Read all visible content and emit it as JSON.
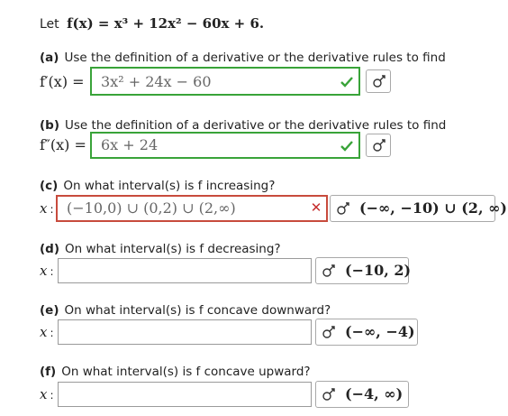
{
  "intro": {
    "text": "Let",
    "function": "f(x) = x³ + 12x² − 60x + 6."
  },
  "parts": [
    {
      "label": "(a)",
      "question": "Use the definition of a derivative or the derivative rules to find",
      "lhs": "f′(x) =",
      "answer": "3x² + 24x − 60",
      "status": "correct"
    },
    {
      "label": "(b)",
      "question": "Use the definition of a derivative or the derivative rules to find",
      "lhs": "f″(x) =",
      "answer": "6x + 24",
      "status": "correct"
    },
    {
      "label": "(c)",
      "question": "On what interval(s) is f increasing?",
      "var": "x",
      "answer": "(−10,0) ∪ (0,2) ∪ (2,∞)",
      "status": "incorrect",
      "correct_answer": "(−∞, −10) ∪ (2, ∞)"
    },
    {
      "label": "(d)",
      "question": "On what interval(s) is f decreasing?",
      "var": "x",
      "answer": "",
      "correct_answer": "(−10, 2)"
    },
    {
      "label": "(e)",
      "question": "On what interval(s) is f concave downward?",
      "var": "x",
      "answer": "",
      "correct_answer": "(−∞, −4)"
    },
    {
      "label": "(f)",
      "question": "On what interval(s) is f concave upward?",
      "var": "x",
      "answer": "",
      "correct_answer": "(−4, ∞)"
    }
  ],
  "colors": {
    "correct_border": "#39a339",
    "incorrect_border": "#c84b3d",
    "check": "#39a339",
    "cross": "#c62f2f"
  },
  "icons": {
    "preview": "preview-icon",
    "check": "check-icon",
    "cross": "x-icon"
  }
}
